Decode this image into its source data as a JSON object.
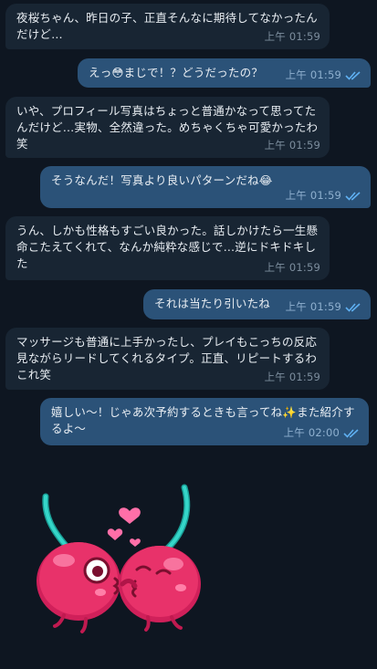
{
  "colors": {
    "background": "#0e1621",
    "incoming_bubble": "#182533",
    "outgoing_bubble": "#2b5278",
    "read_ticks": "#5fb0f2",
    "cherry": "#e8326a",
    "stem": "#35d6c9"
  },
  "messages": [
    {
      "dir": "in",
      "text": "夜桜ちゃん、昨日の子、正直そんなに期待してなかったんだけど…",
      "time": "上午 01:59"
    },
    {
      "dir": "out",
      "text": "えっ😳まじで！？どうだったの？",
      "time": "上午 01:59",
      "read": true
    },
    {
      "dir": "in",
      "text": "いや、プロフィール写真はちょっと普通かなって思ってたんだけど…実物、全然違った。めちゃくちゃ可愛かったわ笑",
      "time": "上午 01:59"
    },
    {
      "dir": "out",
      "text": "そうなんだ！写真より良いパターンだね😂",
      "time": "上午 01:59",
      "read": true
    },
    {
      "dir": "in",
      "text": "うん、しかも性格もすごい良かった。話しかけたら一生懸命こたえてくれて、なんか純粋な感じで…逆にドキドキした",
      "time": "上午 01:59"
    },
    {
      "dir": "out",
      "text": "それは当たり引いたね",
      "time": "上午 01:59",
      "read": true
    },
    {
      "dir": "in",
      "text": "マッサージも普通に上手かったし、プレイもこっちの反応見ながらリードしてくれるタイプ。正直、リピートするわこれ笑",
      "time": "上午 01:59"
    },
    {
      "dir": "out",
      "text": "嬉しい～！じゃあ次予約するときも言ってね✨また紹介するよ～",
      "time": "上午 02:00",
      "read": true
    }
  ],
  "sticker": {
    "icon": "kissing-cherries-sticker"
  }
}
